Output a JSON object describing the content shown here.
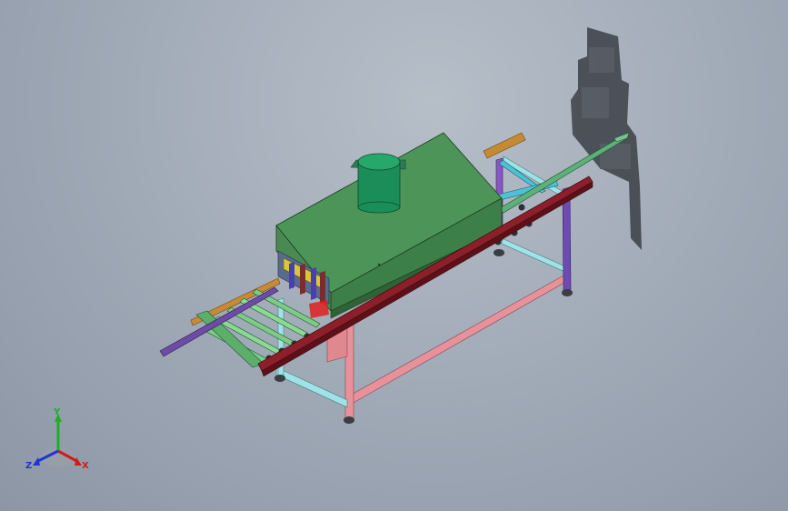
{
  "viewport": {
    "background": "#a7b0bc"
  },
  "triad": {
    "x_label": "X",
    "y_label": "Y",
    "z_label": "Z",
    "x_color": "#d11b1b",
    "y_color": "#1fae2a",
    "z_color": "#2233d6"
  },
  "model": {
    "hood_color": "#3d7f48",
    "chimney_color": "#1d8a55",
    "frame_colors": [
      "#e9919b",
      "#5fb6b0",
      "#4b3fa0",
      "#8a1c25",
      "#c2782a",
      "#6c4ba8"
    ]
  }
}
